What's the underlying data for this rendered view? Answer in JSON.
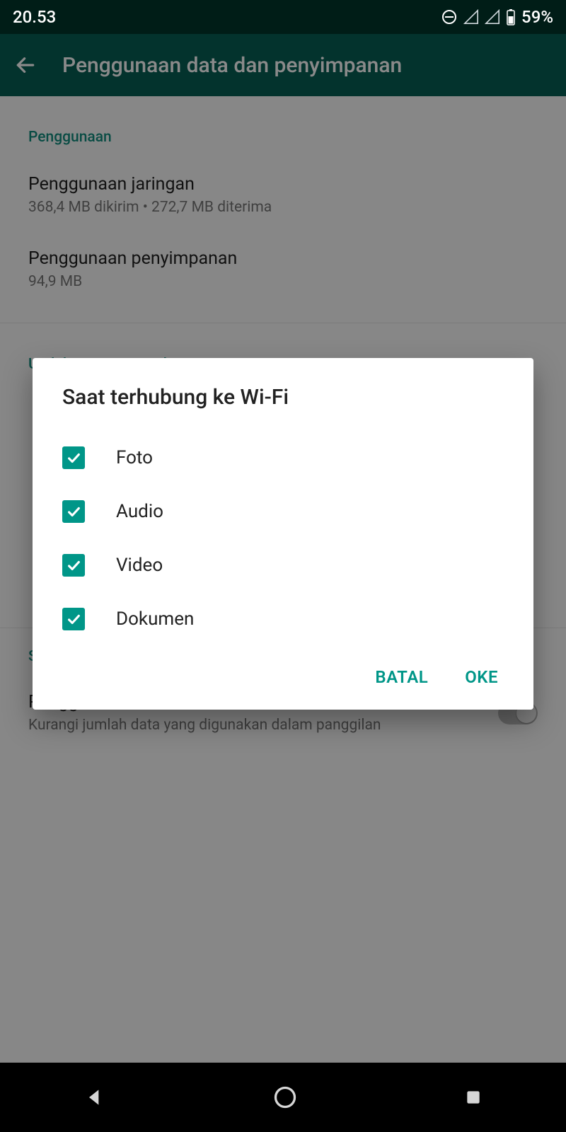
{
  "status": {
    "time": "20.53",
    "battery_pct": "59%"
  },
  "appbar": {
    "title": "Penggunaan data dan penyimpanan"
  },
  "sections": {
    "usage": {
      "header": "Penggunaan",
      "network": {
        "title": "Penggunaan jaringan",
        "sub": "368,4 MB dikirim • 272,7 MB diterima"
      },
      "storage": {
        "title": "Penggunaan penyimpanan",
        "sub": "94,9 MB"
      }
    },
    "autodl": {
      "header": "Unduh otomatis media"
    },
    "callsettings": {
      "title": "Penggunaan data minimum",
      "sub": "Kurangi jumlah data yang digunakan dalam panggilan"
    }
  },
  "dialog": {
    "title": "Saat terhubung ke Wi-Fi",
    "options": [
      {
        "label": "Foto",
        "checked": true
      },
      {
        "label": "Audio",
        "checked": true
      },
      {
        "label": "Video",
        "checked": true
      },
      {
        "label": "Dokumen",
        "checked": true
      }
    ],
    "cancel": "BATAL",
    "ok": "OKE"
  }
}
